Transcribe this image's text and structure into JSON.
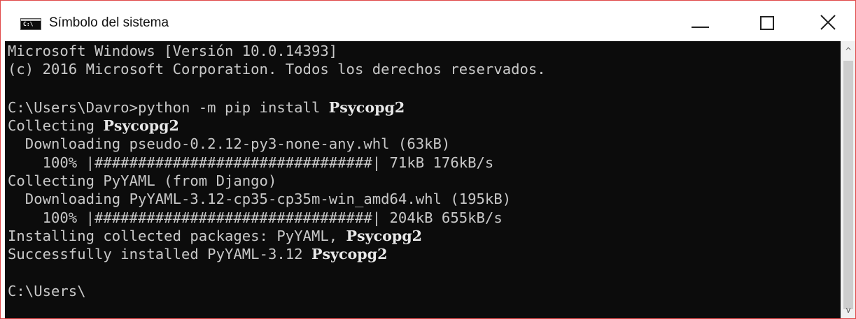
{
  "window": {
    "title": "Símbolo del sistema",
    "icon": "cmd-console-icon",
    "controls": {
      "minimize_icon": "minimize-icon",
      "maximize_icon": "maximize-icon",
      "close_icon": "close-icon"
    }
  },
  "console": {
    "lines": [
      {
        "text": "Microsoft Windows [Versión 10.0.14393]"
      },
      {
        "text": "(c) 2016 Microsoft Corporation. Todos los derechos reservados."
      },
      {
        "text": ""
      },
      {
        "text": "C:\\Users\\Davro>python -m pip install ",
        "bold": "Psycopg2"
      },
      {
        "text": "Collecting ",
        "bold": "Psycopg2"
      },
      {
        "text": "  Downloading pseudo-0.2.12-py3-none-any.whl (63kB)"
      },
      {
        "text": "    100% |################################| 71kB 176kB/s"
      },
      {
        "text": "Collecting PyYAML (from Django)"
      },
      {
        "text": "  Downloading PyYAML-3.12-cp35-cp35m-win_amd64.whl (195kB)"
      },
      {
        "text": "    100% |################################| 204kB 655kB/s"
      },
      {
        "text": "Installing collected packages: PyYAML, ",
        "bold": "Psycopg2"
      },
      {
        "text": "Successfully installed PyYAML-3.12 ",
        "bold": "Psycopg2"
      },
      {
        "text": ""
      },
      {
        "text": "C:\\Users\\"
      }
    ],
    "colors": {
      "background": "#0c0c0c",
      "foreground": "#c8c8c8"
    }
  },
  "scrollbar": {
    "up_icon": "scroll-up-arrow-icon",
    "down_icon": "scroll-down-arrow-icon",
    "up_glyph": "^",
    "down_glyph": "v"
  }
}
